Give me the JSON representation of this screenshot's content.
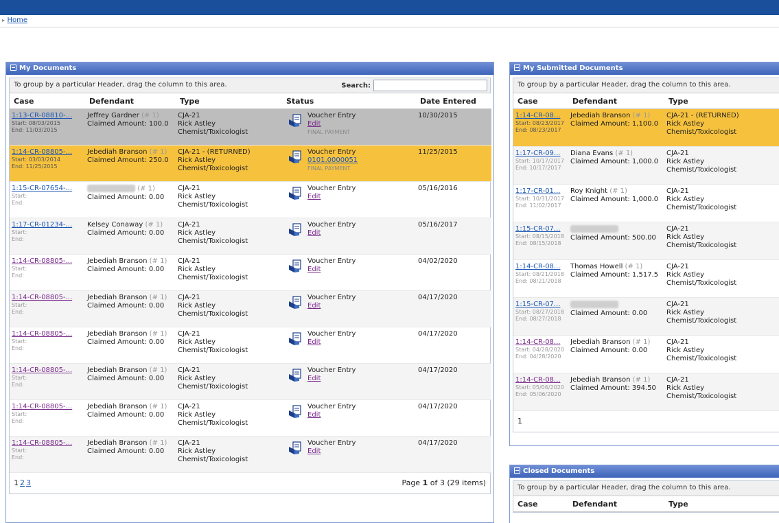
{
  "breadcrumb": {
    "home": "Home"
  },
  "my_documents": {
    "title": "My Documents",
    "group_hint": "To group by a particular Header, drag the column to this area.",
    "search_label": "Search:",
    "search_value": "",
    "columns": [
      "Case",
      "Defendant",
      "Type",
      "Status",
      "Date Entered"
    ],
    "rows": [
      {
        "case": "1:13-CR-08810-...",
        "start": "08/03/2015",
        "end": "11/03/2015",
        "defendant": "Jeffrey Gardner",
        "num": "(# 1)",
        "claimed": "Claimed Amount: 100.0",
        "type1": "CJA-21",
        "type2": "Rick Astley",
        "type3": "Chemist/Toxicologist",
        "status": "Voucher Entry",
        "link": "Edit",
        "final": "FINAL PAYMENT",
        "date": "10/30/2015"
      },
      {
        "case": "1:14-CR-08805-...",
        "start": "03/03/2014",
        "end": "11/25/2015",
        "defendant": "Jebediah Branson",
        "num": "(# 1)",
        "claimed": "Claimed Amount: 250.0",
        "type1": "CJA-21 - (RETURNED)",
        "type2": "Rick Astley",
        "type3": "Chemist/Toxicologist",
        "status": "Voucher Entry",
        "link": "0101.0000051",
        "final": "FINAL PAYMENT",
        "date": "11/25/2015"
      },
      {
        "case": "1:15-CR-07654-...",
        "start": "",
        "end": "",
        "defendant": "",
        "num": "(# 1)",
        "claimed": "Claimed Amount: 0.00",
        "type1": "CJA-21",
        "type2": "Rick Astley",
        "type3": "Chemist/Toxicologist",
        "status": "Voucher Entry",
        "link": "Edit",
        "final": "",
        "date": "05/16/2016"
      },
      {
        "case": "1:17-CR-01234-...",
        "start": "",
        "end": "",
        "defendant": "Kelsey Conaway",
        "num": "(# 1)",
        "claimed": "Claimed Amount: 0.00",
        "type1": "CJA-21",
        "type2": "Rick Astley",
        "type3": "Chemist/Toxicologist",
        "status": "Voucher Entry",
        "link": "Edit",
        "final": "",
        "date": "05/16/2017"
      },
      {
        "case": "1:14-CR-08805-...",
        "start": "",
        "end": "",
        "defendant": "Jebediah Branson",
        "num": "(# 1)",
        "claimed": "Claimed Amount: 0.00",
        "type1": "CJA-21",
        "type2": "Rick Astley",
        "type3": "Chemist/Toxicologist",
        "status": "Voucher Entry",
        "link": "Edit",
        "final": "",
        "date": "04/02/2020"
      },
      {
        "case": "1:14-CR-08805-...",
        "start": "",
        "end": "",
        "defendant": "Jebediah Branson",
        "num": "(# 1)",
        "claimed": "Claimed Amount: 0.00",
        "type1": "CJA-21",
        "type2": "Rick Astley",
        "type3": "Chemist/Toxicologist",
        "status": "Voucher Entry",
        "link": "Edit",
        "final": "",
        "date": "04/17/2020"
      },
      {
        "case": "1:14-CR-08805-...",
        "start": "",
        "end": "",
        "defendant": "Jebediah Branson",
        "num": "(# 1)",
        "claimed": "Claimed Amount: 0.00",
        "type1": "CJA-21",
        "type2": "Rick Astley",
        "type3": "Chemist/Toxicologist",
        "status": "Voucher Entry",
        "link": "Edit",
        "final": "",
        "date": "04/17/2020"
      },
      {
        "case": "1:14-CR-08805-...",
        "start": "",
        "end": "",
        "defendant": "Jebediah Branson",
        "num": "(# 1)",
        "claimed": "Claimed Amount: 0.00",
        "type1": "CJA-21",
        "type2": "Rick Astley",
        "type3": "Chemist/Toxicologist",
        "status": "Voucher Entry",
        "link": "Edit",
        "final": "",
        "date": "04/17/2020"
      },
      {
        "case": "1:14-CR-08805-...",
        "start": "",
        "end": "",
        "defendant": "Jebediah Branson",
        "num": "(# 1)",
        "claimed": "Claimed Amount: 0.00",
        "type1": "CJA-21",
        "type2": "Rick Astley",
        "type3": "Chemist/Toxicologist",
        "status": "Voucher Entry",
        "link": "Edit",
        "final": "",
        "date": "04/17/2020"
      },
      {
        "case": "1:14-CR-08805-...",
        "start": "",
        "end": "",
        "defendant": "Jebediah Branson",
        "num": "(# 1)",
        "claimed": "Claimed Amount: 0.00",
        "type1": "CJA-21",
        "type2": "Rick Astley",
        "type3": "Chemist/Toxicologist",
        "status": "Voucher Entry",
        "link": "Edit",
        "final": "",
        "date": "04/17/2020"
      }
    ],
    "pages": [
      "1",
      "2",
      "3"
    ],
    "page_info_prefix": "Page ",
    "page_current": "1",
    "page_info_suffix": " of 3 (29 items)"
  },
  "submitted_documents": {
    "title": "My Submitted Documents",
    "group_hint": "To group by a particular Header, drag the column to this area.",
    "columns": [
      "Case",
      "Defendant",
      "Type"
    ],
    "rows": [
      {
        "case": "1:14-CR-08...",
        "start": "08/23/2017",
        "end": "08/23/2017",
        "defendant": "Jebediah Branson",
        "num": "(# 1)",
        "claimed": "Claimed Amount: 1,100.0",
        "type1": "CJA-21 - (RETURNED)",
        "type2": "Rick Astley",
        "type3": "Chemist/Toxicologist"
      },
      {
        "case": "1:17-CR-09...",
        "start": "10/17/2017",
        "end": "10/17/2017",
        "defendant": "Diana Evans",
        "num": "(# 1)",
        "claimed": "Claimed Amount: 1,000.0",
        "type1": "CJA-21",
        "type2": "Rick Astley",
        "type3": "Chemist/Toxicologist"
      },
      {
        "case": "1:17-CR-01...",
        "start": "10/31/2017",
        "end": "11/02/2017",
        "defendant": "Roy Knight",
        "num": "(# 1)",
        "claimed": "Claimed Amount: 1,000.0",
        "type1": "CJA-21",
        "type2": "Rick Astley",
        "type3": "Chemist/Toxicologist"
      },
      {
        "case": "1:15-CR-07...",
        "start": "08/15/2018",
        "end": "08/15/2018",
        "defendant": "",
        "num": "",
        "claimed": "Claimed Amount: 500.00",
        "type1": "CJA-21",
        "type2": "Rick Astley",
        "type3": "Chemist/Toxicologist"
      },
      {
        "case": "1:14-CR-08...",
        "start": "08/21/2018",
        "end": "08/21/2018",
        "defendant": "Thomas Howell",
        "num": "(# 1)",
        "claimed": "Claimed Amount: 1,517.5",
        "type1": "CJA-21",
        "type2": "Rick Astley",
        "type3": "Chemist/Toxicologist"
      },
      {
        "case": "1:15-CR-07...",
        "start": "08/27/2018",
        "end": "08/27/2018",
        "defendant": "",
        "num": "",
        "claimed": "Claimed Amount: 0.00",
        "type1": "CJA-21",
        "type2": "Rick Astley",
        "type3": "Chemist/Toxicologist"
      },
      {
        "case": "1:14-CR-08...",
        "start": "04/28/2020",
        "end": "04/28/2020",
        "defendant": "Jebediah Branson",
        "num": "(# 1)",
        "claimed": "Claimed Amount: 0.00",
        "type1": "CJA-21",
        "type2": "Rick Astley",
        "type3": "Chemist/Toxicologist"
      },
      {
        "case": "1:14-CR-08...",
        "start": "05/06/2020",
        "end": "05/06/2020",
        "defendant": "Jebediah Branson",
        "num": "(# 1)",
        "claimed": "Claimed Amount: 394.50",
        "type1": "CJA-21",
        "type2": "Rick Astley",
        "type3": "Chemist/Toxicologist"
      }
    ],
    "pages": [
      "1"
    ]
  },
  "closed_documents": {
    "title": "Closed Documents",
    "group_hint": "To group by a particular Header, drag the column to this area.",
    "columns": [
      "Case",
      "Defendant",
      "Type"
    ]
  },
  "labels": {
    "start": "Start:",
    "end": "End:"
  },
  "colors": {
    "header_blue": "#1a4f9c",
    "returned_yellow": "#f6c23e",
    "final_gray": "#bdbdbd",
    "link_blue": "#1a55b5",
    "visited_purple": "#7a2a8c"
  }
}
